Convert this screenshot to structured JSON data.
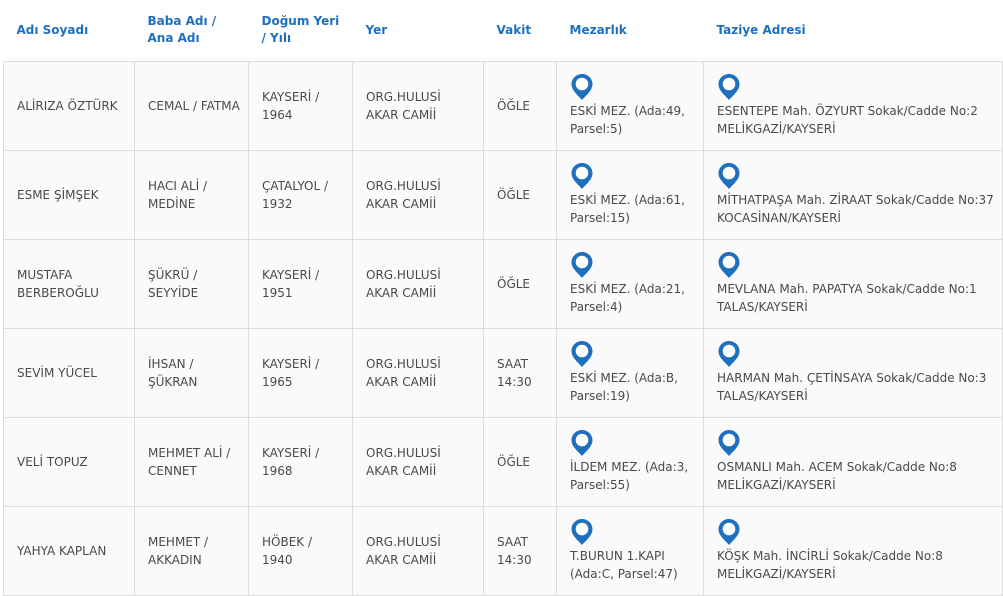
{
  "headers": [
    "Adı Soyadı",
    "Baba Adı / Ana Adı",
    "Doğum Yeri / Yılı",
    "Yer",
    "Vakit",
    "Mezarlık",
    "Taziye Adresi"
  ],
  "accent_color": "#1f6fbf",
  "pin_icon": "map-pin-icon",
  "rows": [
    {
      "name": "ALİRIZA ÖZTÜRK",
      "parents": "CEMAL / FATMA",
      "birth": "KAYSERİ / 1964",
      "place": "ORG.HULUSİ AKAR CAMİİ",
      "time": "ÖĞLE",
      "cemetery": "ESKİ MEZ. (Ada:49, Parsel:5)",
      "address": "ESENTEPE Mah. ÖZYURT Sokak/Cadde No:2 MELİKGAZİ/KAYSERİ"
    },
    {
      "name": "ESME ŞİMŞEK",
      "parents": "HACI ALİ / MEDİNE",
      "birth": "ÇATALYOL / 1932",
      "place": "ORG.HULUSİ AKAR CAMİİ",
      "time": "ÖĞLE",
      "cemetery": "ESKİ MEZ. (Ada:61, Parsel:15)",
      "address": "MİTHATPAŞA Mah. ZİRAAT Sokak/Cadde No:37 KOCASİNAN/KAYSERİ"
    },
    {
      "name": "MUSTAFA BERBEROĞLU",
      "parents": "ŞÜKRÜ / SEYYİDE",
      "birth": "KAYSERİ / 1951",
      "place": "ORG.HULUSİ AKAR CAMİİ",
      "time": "ÖĞLE",
      "cemetery": "ESKİ MEZ. (Ada:21, Parsel:4)",
      "address": "MEVLANA Mah. PAPATYA Sokak/Cadde No:1 TALAS/KAYSERİ"
    },
    {
      "name": "SEVİM YÜCEL",
      "parents": "İHSAN / ŞÜKRAN",
      "birth": "KAYSERİ / 1965",
      "place": "ORG.HULUSİ AKAR CAMİİ",
      "time": "SAAT 14:30",
      "cemetery": "ESKİ MEZ. (Ada:B, Parsel:19)",
      "address": "HARMAN Mah. ÇETİNSAYA Sokak/Cadde No:3 TALAS/KAYSERİ"
    },
    {
      "name": "VELİ TOPUZ",
      "parents": "MEHMET ALİ / CENNET",
      "birth": "KAYSERİ / 1968",
      "place": "ORG.HULUSİ AKAR CAMİİ",
      "time": "ÖĞLE",
      "cemetery": "İLDEM MEZ. (Ada:3, Parsel:55)",
      "address": "OSMANLI Mah. ACEM Sokak/Cadde No:8 MELİKGAZİ/KAYSERİ"
    },
    {
      "name": "YAHYA KAPLAN",
      "parents": "MEHMET / AKKADIN",
      "birth": "HÖBEK / 1940",
      "place": "ORG.HULUSİ AKAR CAMİİ",
      "time": "SAAT 14:30",
      "cemetery": "T.BURUN 1.KAPI (Ada:C, Parsel:47)",
      "address": "KÖŞK Mah. İNCİRLİ Sokak/Cadde No:8 MELİKGAZİ/KAYSERİ"
    }
  ]
}
